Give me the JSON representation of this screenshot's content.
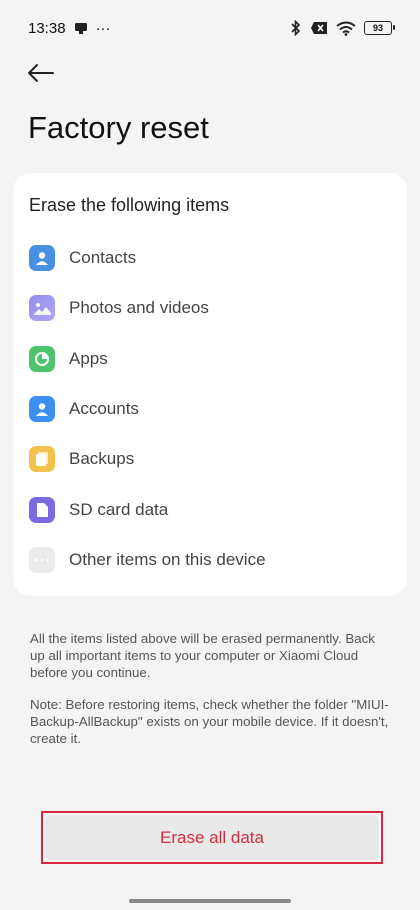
{
  "status_bar": {
    "time": "13:38",
    "dots": "···",
    "battery": "93"
  },
  "header": {
    "title": "Factory reset"
  },
  "card": {
    "title": "Erase the following items",
    "items": [
      {
        "label": "Contacts",
        "icon": "contacts-icon",
        "color": "#4a90e2"
      },
      {
        "label": "Photos and videos",
        "icon": "photos-icon",
        "color": "#7b7fe0"
      },
      {
        "label": "Apps",
        "icon": "apps-icon",
        "color": "#4bc46d"
      },
      {
        "label": "Accounts",
        "icon": "accounts-icon",
        "color": "#3d8ff0"
      },
      {
        "label": "Backups",
        "icon": "backups-icon",
        "color": "#f2c14e"
      },
      {
        "label": "SD card data",
        "icon": "sd-card-icon",
        "color": "#7b6be0"
      },
      {
        "label": "Other items on this device",
        "icon": "more-icon",
        "color": "#e8e8e8"
      }
    ]
  },
  "notes": {
    "warning": "All the items listed above will be erased permanently. Back up all important items to your computer or Xiaomi Cloud before you continue.",
    "restore": "Note: Before restoring items, check whether the folder \"MIUI-Backup-AllBackup\" exists on your mobile device. If it doesn't, create it."
  },
  "actions": {
    "erase_label": "Erase all data",
    "erase_color": "#d12f3f"
  }
}
